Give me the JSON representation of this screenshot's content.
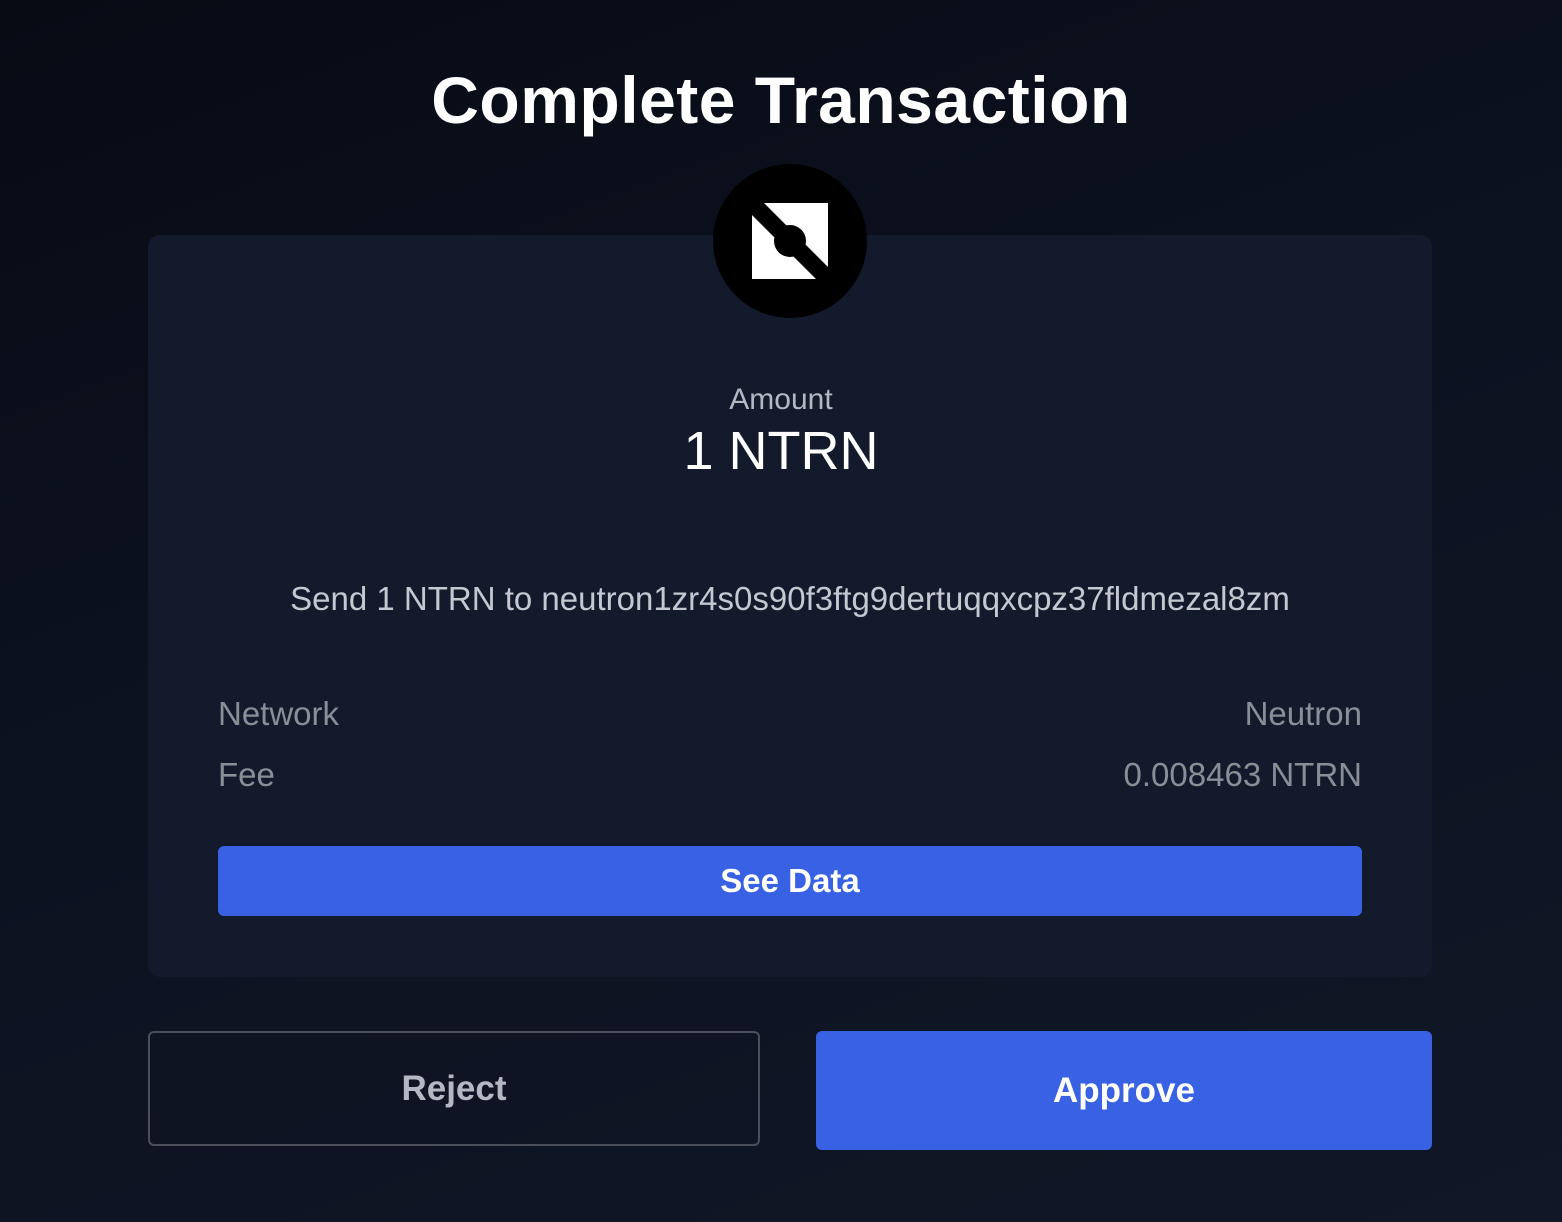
{
  "header": {
    "title": "Complete Transaction"
  },
  "logo": {
    "icon": "neutron-logo-icon",
    "background": "#000000"
  },
  "summary": {
    "amount_label": "Amount",
    "amount_value": "1 NTRN",
    "description": "Send 1 NTRN to neutron1zr4s0s90f3ftg9dertuqqxcpz37fldmezal8zm"
  },
  "details": {
    "network_label": "Network",
    "network_value": "Neutron",
    "fee_label": "Fee",
    "fee_value": "0.008463 NTRN"
  },
  "actions": {
    "see_data_label": "See Data",
    "reject_label": "Reject",
    "approve_label": "Approve"
  },
  "colors": {
    "accent": "#3861e3",
    "card_background": "#131a2c",
    "page_background": "#0c1220"
  }
}
